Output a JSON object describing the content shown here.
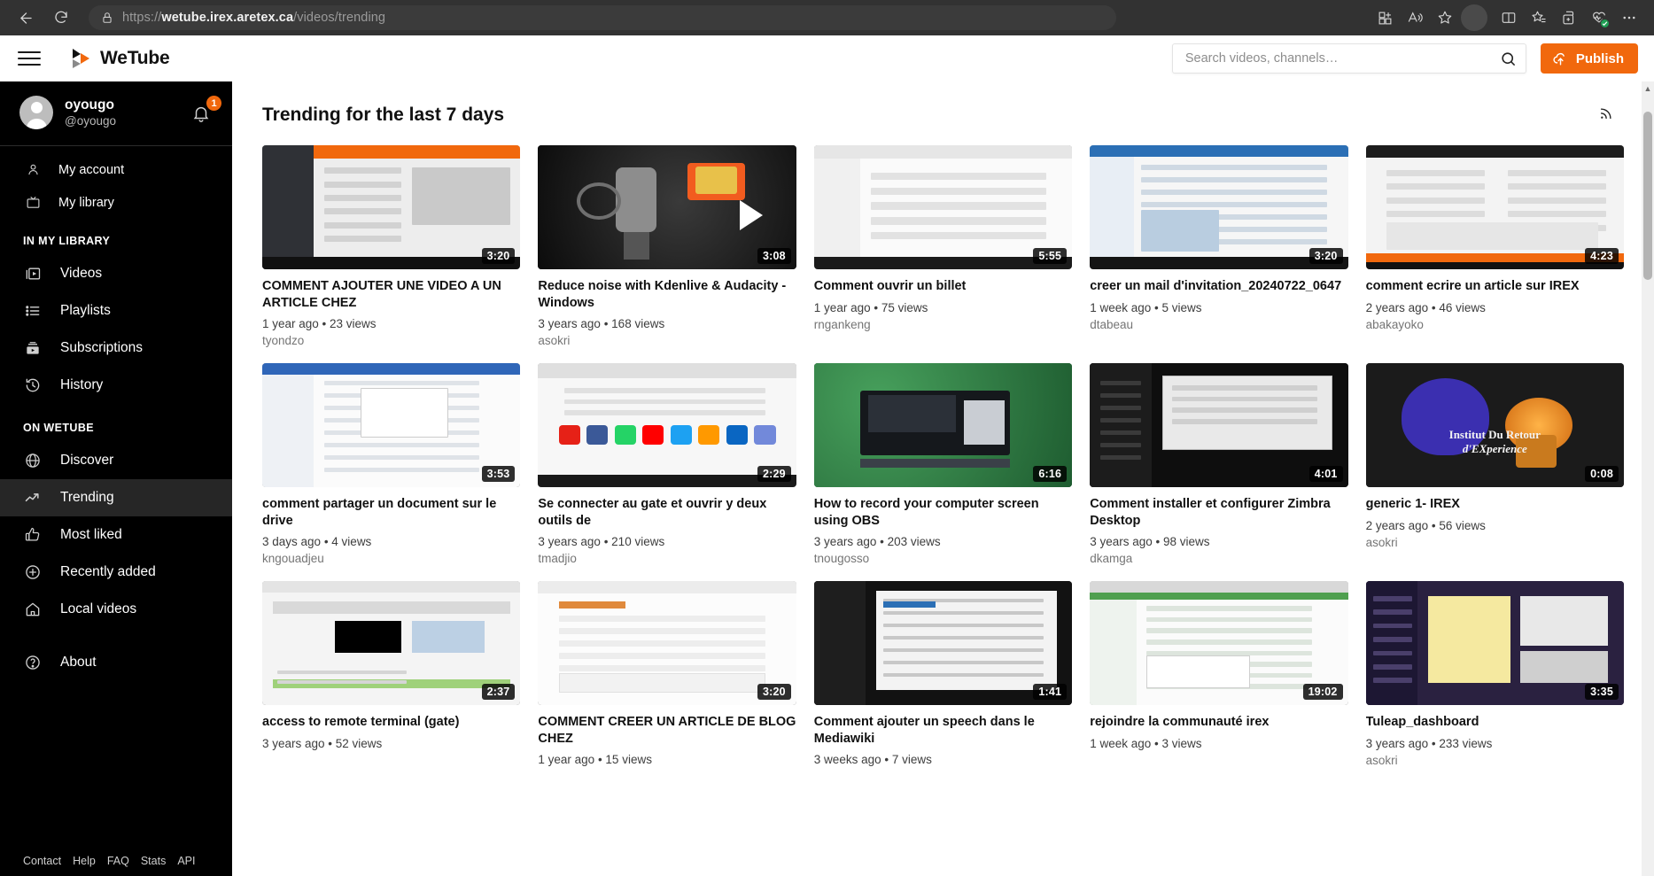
{
  "browser": {
    "url_protocol": "https://",
    "url_host": "wetube.irex.aretex.ca",
    "url_path": "/videos/trending",
    "back_icon": "back-arrow-icon",
    "reload_icon": "reload-icon",
    "lock_icon": "lock-icon",
    "toolbar_icons": [
      "split-add-icon",
      "read-aloud-icon",
      "favorite-star-icon",
      "split-screen-icon",
      "favorites-list-icon",
      "collections-icon",
      "browser-essentials-icon",
      "settings-ellipsis-icon"
    ]
  },
  "header": {
    "menu_icon": "hamburger-menu-icon",
    "brand": "WeTube",
    "search_placeholder": "Search videos, channels…",
    "search_value": "",
    "search_icon": "search-icon",
    "publish_label": "Publish",
    "publish_icon": "cloud-upload-icon",
    "accent_color": "#f1680d"
  },
  "sidebar": {
    "user": {
      "display_name": "oyougo",
      "handle": "@oyougo",
      "notification_count": "1",
      "avatar_icon": "user-avatar-icon",
      "bell_icon": "bell-icon"
    },
    "top_items": [
      {
        "label": "My account",
        "icon": "person-icon"
      },
      {
        "label": "My library",
        "icon": "tv-icon"
      }
    ],
    "library_section": "IN MY LIBRARY",
    "library_items": [
      {
        "label": "Videos",
        "icon": "videos-icon"
      },
      {
        "label": "Playlists",
        "icon": "playlist-icon"
      },
      {
        "label": "Subscriptions",
        "icon": "subscriptions-icon"
      },
      {
        "label": "History",
        "icon": "history-icon"
      }
    ],
    "wetube_section": "ON WETUBE",
    "wetube_items": [
      {
        "label": "Discover",
        "icon": "globe-icon",
        "active": false
      },
      {
        "label": "Trending",
        "icon": "trending-up-icon",
        "active": true
      },
      {
        "label": "Most liked",
        "icon": "thumbs-up-icon",
        "active": false
      },
      {
        "label": "Recently added",
        "icon": "plus-circle-icon",
        "active": false
      },
      {
        "label": "Local videos",
        "icon": "home-icon",
        "active": false
      }
    ],
    "about_item": {
      "label": "About",
      "icon": "question-circle-icon"
    },
    "footer_links": [
      "Contact",
      "Help",
      "FAQ",
      "Stats",
      "API"
    ]
  },
  "main": {
    "title": "Trending for the last 7 days",
    "rss_icon": "rss-feed-icon",
    "videos": [
      {
        "title": "COMMENT AJOUTER UNE VIDEO A UN ARTICLE CHEZ",
        "age": "1 year ago",
        "views": "23 views",
        "author": "tyondzo",
        "duration": "3:20",
        "art": "doc-orange"
      },
      {
        "title": "Reduce noise with Kdenlive & Audacity - Windows",
        "age": "3 years ago",
        "views": "168 views",
        "author": "asokri",
        "duration": "3:08",
        "art": "mic"
      },
      {
        "title": "Comment ouvrir un billet",
        "age": "1 year ago",
        "views": "75 views",
        "author": "rngankeng",
        "duration": "5:55",
        "art": "form"
      },
      {
        "title": "creer un mail d'invitation_20240722_0647",
        "age": "1 week ago",
        "views": "5 views",
        "author": "dtabeau",
        "duration": "3:20",
        "art": "blue-app"
      },
      {
        "title": "comment ecrire un article sur IREX",
        "age": "2 years ago",
        "views": "46 views",
        "author": "abakayoko",
        "duration": "4:23",
        "art": "editor-orange"
      },
      {
        "title": "comment partager un document sur le drive",
        "age": "3 days ago",
        "views": "4 views",
        "author": "kngouadjeu",
        "duration": "3:53",
        "art": "drive"
      },
      {
        "title": "Se connecter au gate et ouvrir y deux outils de",
        "age": "3 years ago",
        "views": "210 views",
        "author": "tmadjio",
        "duration": "2:29",
        "art": "icons-row"
      },
      {
        "title": "How to record your computer screen using OBS",
        "age": "3 years ago",
        "views": "203 views",
        "author": "tnougosso",
        "duration": "6:16",
        "art": "obs-green"
      },
      {
        "title": "Comment installer et configurer Zimbra Desktop",
        "age": "3 years ago",
        "views": "98 views",
        "author": "dkamga",
        "duration": "4:01",
        "art": "zimbra"
      },
      {
        "title": "generic 1- IREX",
        "age": "2 years ago",
        "views": "56 views",
        "author": "asokri",
        "duration": "0:08",
        "art": "irex-brand",
        "brand_line1": "Institut Du Retour",
        "brand_line2": "d'EXperience"
      },
      {
        "title": "access to remote terminal (gate)",
        "age": "3 years ago",
        "views": "52 views",
        "author": "",
        "duration": "2:37",
        "art": "terminal-green"
      },
      {
        "title": "COMMENT CREER UN ARTICLE DE BLOG CHEZ",
        "age": "1 year ago",
        "views": "15 views",
        "author": "",
        "duration": "3:20",
        "art": "blog-form"
      },
      {
        "title": "Comment ajouter un speech dans le Mediawiki",
        "age": "3 weeks ago",
        "views": "7 views",
        "author": "",
        "duration": "1:41",
        "art": "dark-wiki"
      },
      {
        "title": "rejoindre la communauté irex",
        "age": "1 week ago",
        "views": "3 views",
        "author": "",
        "duration": "19:02",
        "art": "green-site"
      },
      {
        "title": "Tuleap_dashboard",
        "age": "3 years ago",
        "views": "233 views",
        "author": "asokri",
        "duration": "3:35",
        "art": "tuleap-purple"
      }
    ]
  }
}
